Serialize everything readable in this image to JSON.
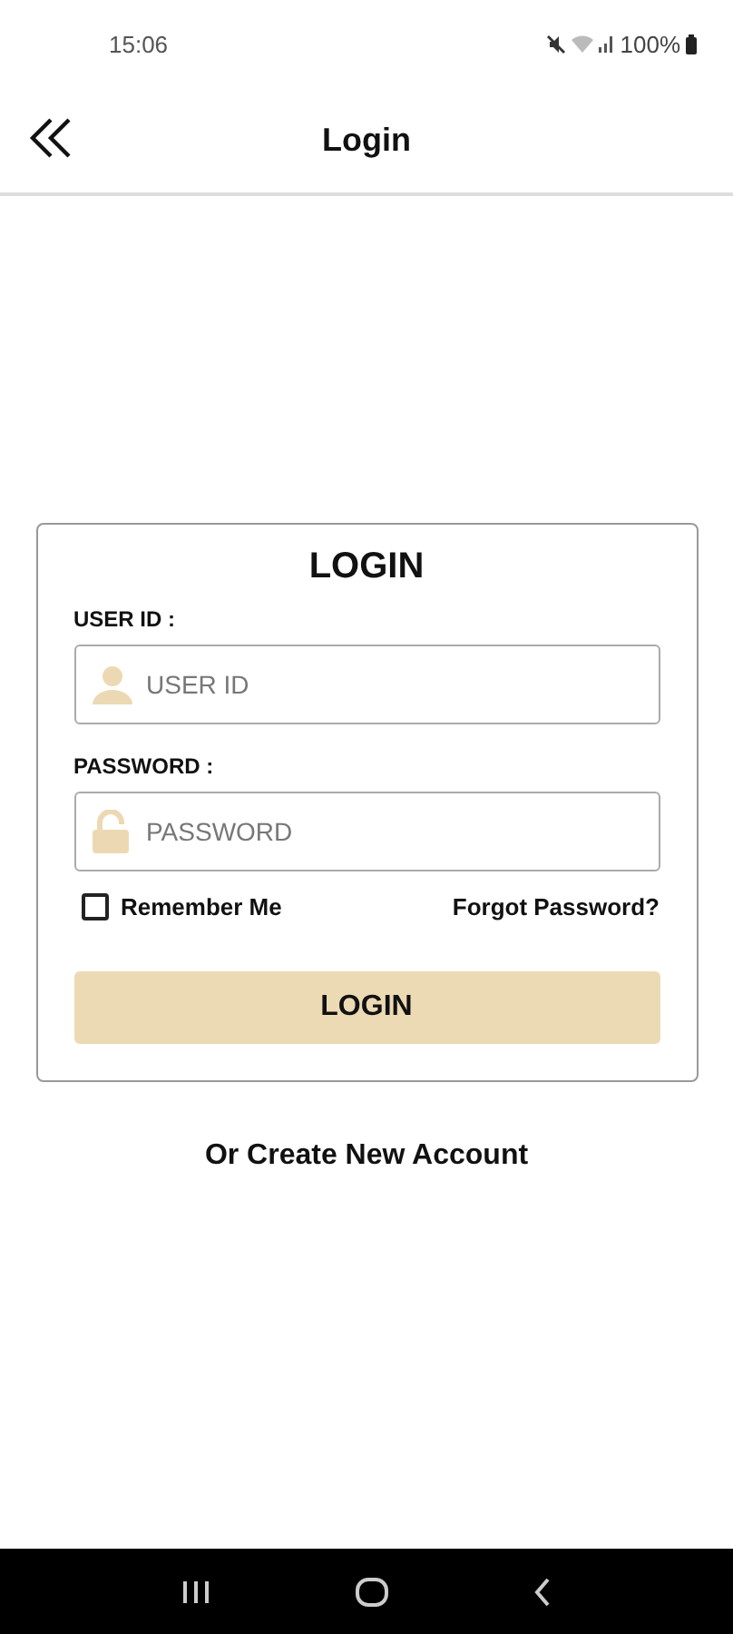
{
  "status_bar": {
    "time": "15:06",
    "battery": "100%"
  },
  "header": {
    "title": "Login"
  },
  "card": {
    "title": "LOGIN",
    "fields": [
      {
        "kind": "user",
        "label": "USER ID :",
        "placeholder": "USER ID"
      },
      {
        "kind": "lock",
        "label": "PASSWORD :",
        "placeholder": "PASSWORD"
      }
    ],
    "remember": {
      "label": "Remember Me",
      "checked": false
    },
    "forgot": "Forgot Password?",
    "button": "LOGIN"
  },
  "create_account": "Or Create New Account"
}
